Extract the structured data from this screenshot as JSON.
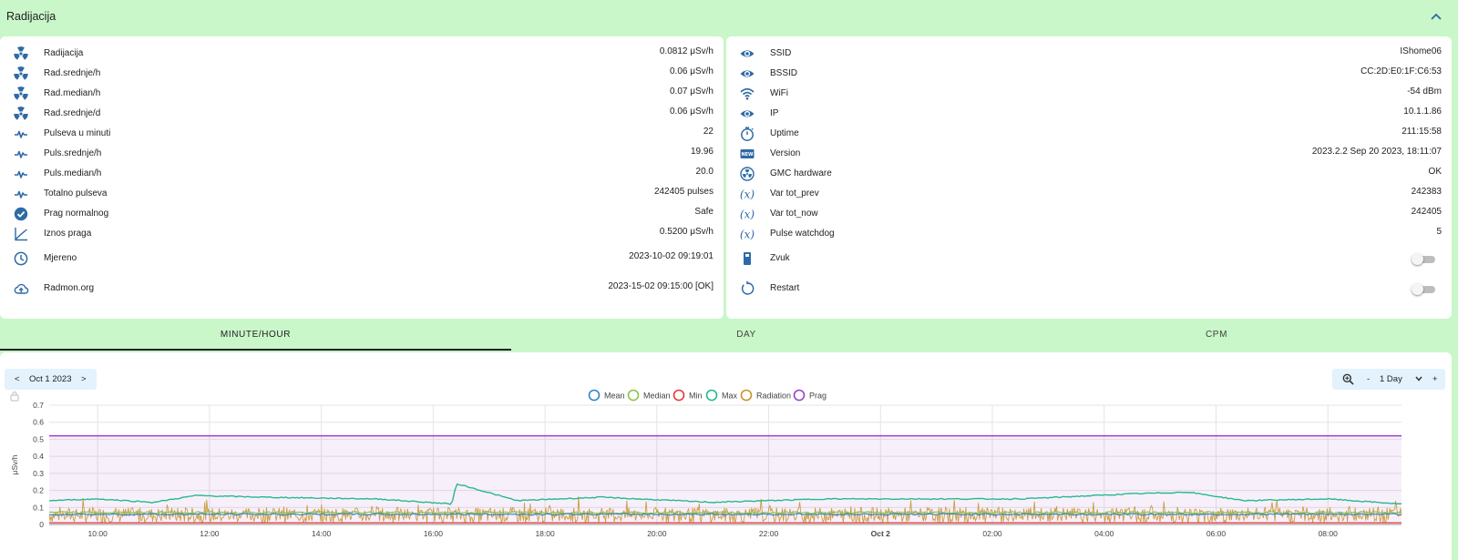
{
  "header": {
    "title": "Radijacija"
  },
  "left_rows": [
    {
      "icon": "radiation-icon",
      "label": "Radijacija",
      "value": "0.0812 μSv/h"
    },
    {
      "icon": "radiation-icon",
      "label": "Rad.srednje/h",
      "value": "0.06 μSv/h"
    },
    {
      "icon": "radiation-icon",
      "label": "Rad.median/h",
      "value": "0.07 μSv/h"
    },
    {
      "icon": "radiation-icon",
      "label": "Rad.srednje/d",
      "value": "0.06 μSv/h"
    },
    {
      "icon": "pulse-icon",
      "label": "Pulseva u minuti",
      "value": "22"
    },
    {
      "icon": "pulse-icon",
      "label": "Puls.srednje/h",
      "value": "19.96"
    },
    {
      "icon": "pulse-icon",
      "label": "Puls.median/h",
      "value": "20.0"
    },
    {
      "icon": "pulse-icon",
      "label": "Totalno pulseva",
      "value": "242405 pulses"
    },
    {
      "icon": "check-circle-icon",
      "label": "Prag normalnog",
      "value": "Safe"
    },
    {
      "icon": "line-chart-icon",
      "label": "Iznos praga",
      "value": "0.5200 μSv/h"
    },
    {
      "icon": "clock-icon",
      "label": "Mjereno",
      "value": "2023-10-02 09:19:01"
    },
    {
      "icon": "cloud-upload-icon",
      "label": "Radmon.org",
      "value": "2023-15-02 09:15:00 [OK]"
    }
  ],
  "right_rows": [
    {
      "icon": "eye-icon",
      "label": "SSID",
      "value": "IShome06"
    },
    {
      "icon": "eye-icon",
      "label": "BSSID",
      "value": "CC:2D:E0:1F:C6:53"
    },
    {
      "icon": "wifi-icon",
      "label": "WiFi",
      "value": "-54 dBm"
    },
    {
      "icon": "eye-icon",
      "label": "IP",
      "value": "10.1.1.86"
    },
    {
      "icon": "timer-icon",
      "label": "Uptime",
      "value": "211:15:58"
    },
    {
      "icon": "new-badge-icon",
      "label": "Version",
      "value": "2023.2.2 Sep 20 2023, 18:11:07"
    },
    {
      "icon": "radioactive-circle-icon",
      "label": "GMC hardware",
      "value": "OK"
    },
    {
      "icon": "variable-icon",
      "label": "Var tot_prev",
      "value": "242383"
    },
    {
      "icon": "variable-icon",
      "label": "Var tot_now",
      "value": "242405"
    },
    {
      "icon": "variable-icon",
      "label": "Pulse watchdog",
      "value": "5"
    },
    {
      "icon": "switch-device-icon",
      "label": "Zvuk",
      "value": ""
    },
    {
      "icon": "restart-icon",
      "label": "Restart",
      "value": ""
    }
  ],
  "tabs": [
    "MINUTE/HOUR",
    "DAY",
    "CPM"
  ],
  "active_tab": "MINUTE/HOUR",
  "date_nav": {
    "prev": "<",
    "date": "Oct 1 2023",
    "next": ">"
  },
  "zoom": {
    "minus": "-",
    "range": "1 Day",
    "plus": "+"
  },
  "colors": {
    "accent": "#2e6aa6",
    "mean": "#2f87c9",
    "median": "#8bc34a",
    "min": "#e53935",
    "max": "#26b890",
    "radiation": "#c9922b",
    "prag": "#9c3fd1"
  },
  "chart_data": {
    "type": "line",
    "ylabel": "μSv/h",
    "ylim": [
      0,
      0.7
    ],
    "yticks": [
      "0",
      "0.1",
      "0.2",
      "0.3",
      "0.4",
      "0.5",
      "0.6",
      "0.7"
    ],
    "xticks": [
      "10:00",
      "12:00",
      "14:00",
      "16:00",
      "18:00",
      "20:00",
      "22:00",
      "Oct 2",
      "02:00",
      "04:00",
      "06:00",
      "08:00"
    ],
    "x_range": [
      "2023-10-01 09:08",
      "2023-10-02 09:19"
    ],
    "legend": [
      "Mean",
      "Median",
      "Min",
      "Max",
      "Radiation",
      "Prag"
    ],
    "series": [
      {
        "name": "Prag",
        "values": [
          {
            "x": "2023-10-01 09:08",
            "y": 0.52
          },
          {
            "x": "2023-10-02 09:19",
            "y": 0.52
          }
        ]
      },
      {
        "name": "Max",
        "values": [
          {
            "x": "2023-10-01 09:08",
            "y": 0.14
          },
          {
            "x": "2023-10-01 10:00",
            "y": 0.15
          },
          {
            "x": "2023-10-01 11:00",
            "y": 0.13
          },
          {
            "x": "2023-10-01 11:45",
            "y": 0.17
          },
          {
            "x": "2023-10-01 13:00",
            "y": 0.16
          },
          {
            "x": "2023-10-01 15:00",
            "y": 0.15
          },
          {
            "x": "2023-10-01 16:20",
            "y": 0.12
          },
          {
            "x": "2023-10-01 16:25",
            "y": 0.24
          },
          {
            "x": "2023-10-01 17:30",
            "y": 0.14
          },
          {
            "x": "2023-10-01 19:00",
            "y": 0.16
          },
          {
            "x": "2023-10-01 21:00",
            "y": 0.13
          },
          {
            "x": "2023-10-01 23:00",
            "y": 0.15
          },
          {
            "x": "2023-10-02 01:00",
            "y": 0.15
          },
          {
            "x": "2023-10-02 02:30",
            "y": 0.15
          },
          {
            "x": "2023-10-02 04:30",
            "y": 0.18
          },
          {
            "x": "2023-10-02 05:30",
            "y": 0.19
          },
          {
            "x": "2023-10-02 06:30",
            "y": 0.14
          },
          {
            "x": "2023-10-02 08:00",
            "y": 0.15
          },
          {
            "x": "2023-10-02 09:19",
            "y": 0.12
          }
        ]
      },
      {
        "name": "Mean",
        "values": [
          {
            "x": "2023-10-01 09:08",
            "y": 0.06
          },
          {
            "x": "2023-10-02 09:19",
            "y": 0.06
          }
        ]
      },
      {
        "name": "Median",
        "values": [
          {
            "x": "2023-10-01 09:08",
            "y": 0.07
          },
          {
            "x": "2023-10-02 09:19",
            "y": 0.07
          }
        ]
      },
      {
        "name": "Min",
        "values": [
          {
            "x": "2023-10-01 09:08",
            "y": 0.01
          },
          {
            "x": "2023-10-02 09:19",
            "y": 0.01
          }
        ]
      },
      {
        "name": "Radiation",
        "values": "noisy per-minute readings between 0.0 and 0.17 μSv/h"
      }
    ]
  }
}
